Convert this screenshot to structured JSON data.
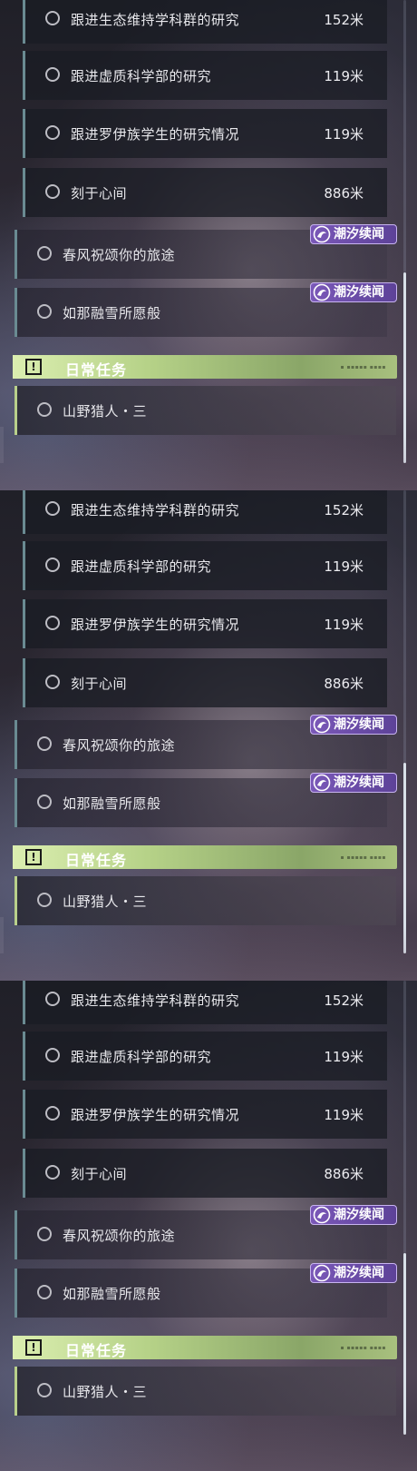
{
  "tracked_quests": [
    {
      "label": "跟进生态维持学科群的研究",
      "distance": "152米"
    },
    {
      "label": "跟进虚质科学部的研究",
      "distance": "119米"
    },
    {
      "label": "跟进罗伊族学生的研究情况",
      "distance": "119米"
    },
    {
      "label": "刻于心间",
      "distance": "886米"
    }
  ],
  "event_quests": [
    {
      "label": "春风祝颂你的旅途",
      "badge": "潮汐续闻"
    },
    {
      "label": "如那融雪所愿般",
      "badge": "潮汐续闻"
    }
  ],
  "daily_section": {
    "title": "日常任务",
    "icon": "exclamation-icon",
    "quests": [
      {
        "label": "山野猎人・三"
      }
    ]
  },
  "colors": {
    "accent_green": "#b6d288",
    "badge_purple": "#6b4ca8",
    "row_bar": "#6a8b92"
  },
  "panel_count": 3
}
